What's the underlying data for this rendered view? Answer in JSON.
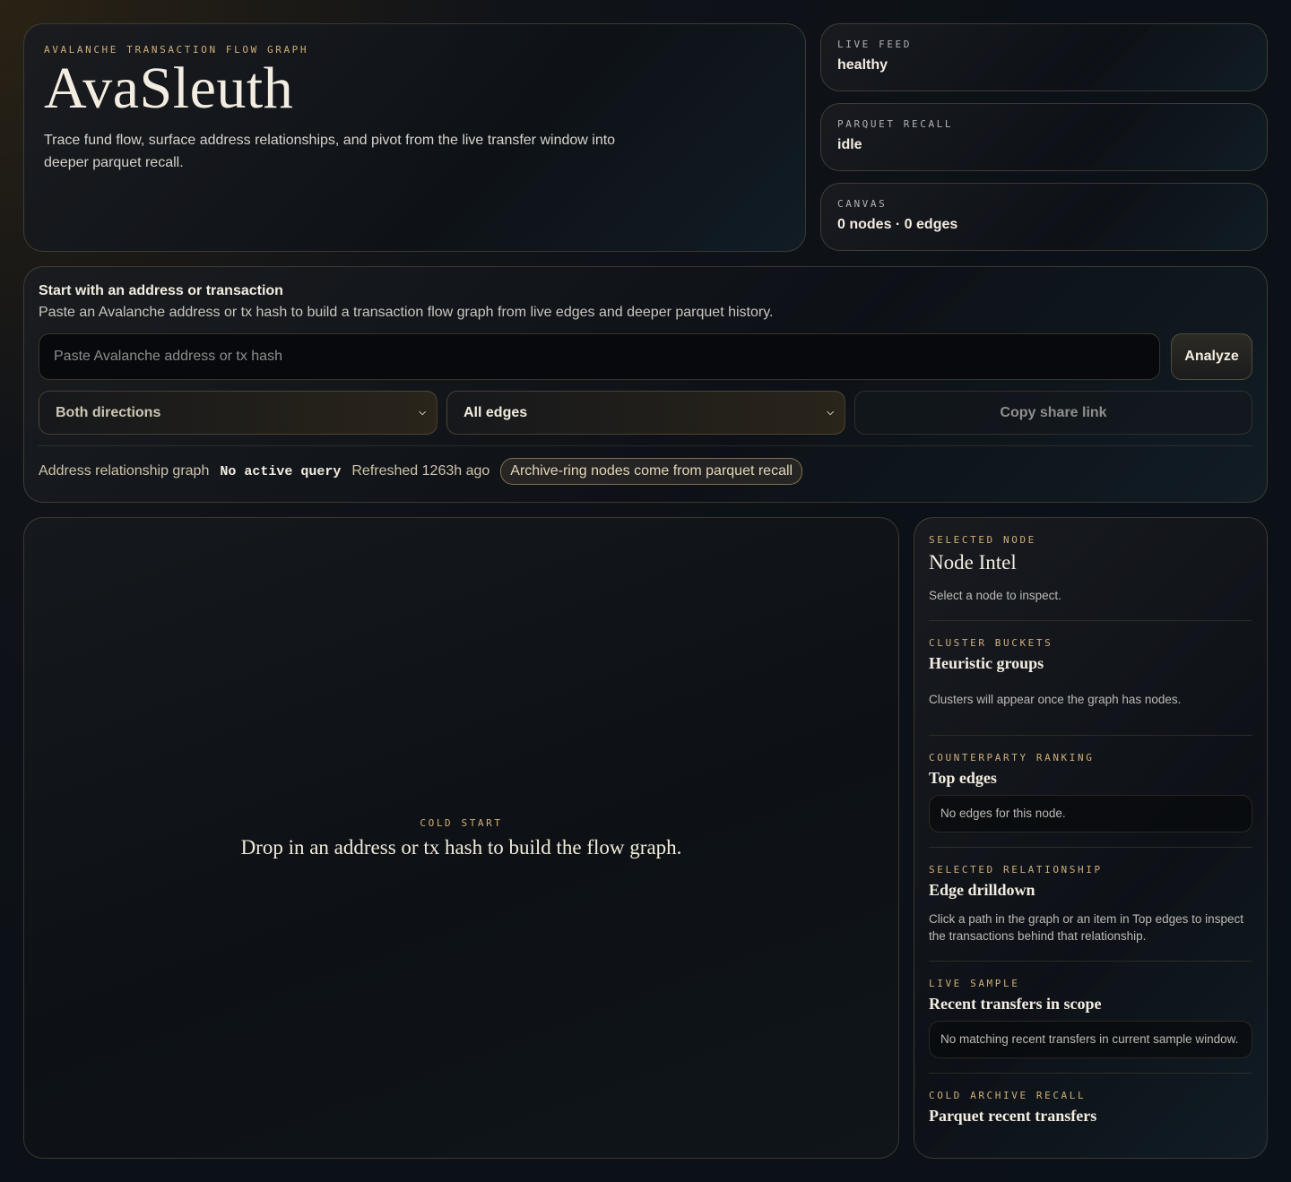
{
  "hero": {
    "kicker": "AVALANCHE TRANSACTION FLOW GRAPH",
    "title": "AvaSleuth",
    "description": "Trace fund flow, surface address relationships, and pivot from the live transfer window into deeper parquet recall."
  },
  "stats": {
    "feed": {
      "label": "LIVE FEED",
      "value": "healthy"
    },
    "parquet": {
      "label": "PARQUET RECALL",
      "value": "idle"
    },
    "canvas": {
      "label": "CANVAS",
      "value": "0 nodes · 0 edges"
    }
  },
  "search": {
    "title": "Start with an address or transaction",
    "subtitle": "Paste an Avalanche address or tx hash to build a transaction flow graph from live edges and deeper parquet history.",
    "placeholder": "Paste Avalanche address or tx hash",
    "value": "",
    "analyze_label": "Analyze",
    "direction_select": "Both directions",
    "edges_select": "All edges",
    "share_label": "Copy share link"
  },
  "status": {
    "graph_label": "Address relationship graph",
    "query": "No active query",
    "refreshed": "Refreshed 1263h ago",
    "archive_note": "Archive-ring nodes come from parquet recall"
  },
  "graph": {
    "kicker": "COLD START",
    "message": "Drop in an address or tx hash to build the flow graph."
  },
  "side": {
    "node": {
      "kicker": "SELECTED NODE",
      "title": "Node Intel",
      "text": "Select a node to inspect."
    },
    "clusters": {
      "kicker": "CLUSTER BUCKETS",
      "title": "Heuristic groups",
      "text": "Clusters will appear once the graph has nodes."
    },
    "counterparty": {
      "kicker": "COUNTERPARTY RANKING",
      "title": "Top edges",
      "text": "No edges for this node."
    },
    "relationship": {
      "kicker": "SELECTED RELATIONSHIP",
      "title": "Edge drilldown",
      "text": "Click a path in the graph or an item in Top edges to inspect the transactions behind that relationship."
    },
    "live_sample": {
      "kicker": "LIVE SAMPLE",
      "title": "Recent transfers in scope",
      "text": "No matching recent transfers in current sample window."
    },
    "archive": {
      "kicker": "COLD ARCHIVE RECALL",
      "title": "Parquet recent transfers"
    }
  }
}
